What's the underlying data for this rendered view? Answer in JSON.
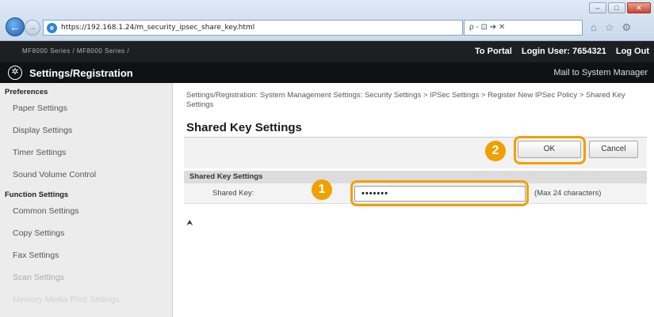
{
  "browser": {
    "url": "https://192.168.1.24/m_security_ipsec_share_key.html",
    "toolbar_text": "ρ - ⊡ ➔ ✕",
    "win_minimize": "–",
    "win_maximize": "□",
    "win_close": "✕",
    "ie_glyph": "e",
    "back_glyph": "←",
    "forward_glyph": "→",
    "home_glyph": "⌂",
    "star_glyph": "☆",
    "gear_glyph": "⚙"
  },
  "topbar": {
    "device_name": "MF8000 Series / MF8000 Series /",
    "portal": "To Portal",
    "login_user": "Login User:  7654321",
    "logout": "Log Out"
  },
  "header": {
    "settings_glyph": "✲",
    "title": "Settings/Registration",
    "mail_link": "Mail to System Manager"
  },
  "sidebar": {
    "section_preferences": "Preferences",
    "items_preferences": [
      "Paper Settings",
      "Display Settings",
      "Timer Settings",
      "Sound Volume Control"
    ],
    "section_function": "Function Settings",
    "items_function": [
      "Common Settings",
      "Copy Settings",
      "Fax Settings",
      "Scan Settings",
      "Memory Media Print Settings"
    ]
  },
  "main": {
    "breadcrumb": "Settings/Registration: System Management Settings: Security Settings > IPSec Settings > Register New IPSec Policy > Shared Key Settings",
    "page_title": "Shared Key Settings",
    "ok_label": "OK",
    "cancel_label": "Cancel",
    "callout_ok": "2",
    "callout_input": "1",
    "section_title": "Shared Key Settings",
    "field_label": "Shared Key:",
    "field_value": "•••••••",
    "field_hint": "(Max 24 characters)",
    "top_arrow": "⮝"
  },
  "colors": {
    "highlight": "#f0a000",
    "header_bg": "#101112",
    "topbar_bg": "#1e1f21"
  }
}
